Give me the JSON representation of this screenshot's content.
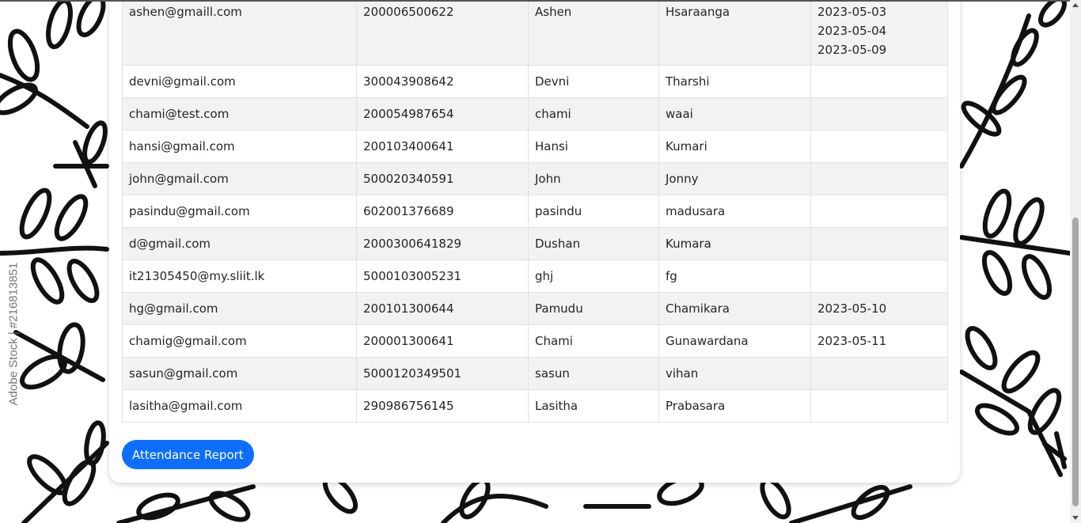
{
  "watermark": "Adobe Stock | #216813851",
  "table": {
    "rows": [
      {
        "email": "ashen@gmaill.com",
        "nic": "200006500622",
        "first": "Ashen",
        "last": "Hsaraanga",
        "dates": [
          "2023-05-03",
          "2023-05-04",
          "2023-05-09"
        ]
      },
      {
        "email": "devni@gmail.com",
        "nic": "300043908642",
        "first": "Devni",
        "last": "Tharshi",
        "dates": []
      },
      {
        "email": "chami@test.com",
        "nic": "200054987654",
        "first": "chami",
        "last": "waai",
        "dates": []
      },
      {
        "email": "hansi@gmail.com",
        "nic": "200103400641",
        "first": "Hansi",
        "last": "Kumari",
        "dates": []
      },
      {
        "email": "john@gmail.com",
        "nic": "500020340591",
        "first": "John",
        "last": "Jonny",
        "dates": []
      },
      {
        "email": "pasindu@gmail.com",
        "nic": "602001376689",
        "first": "pasindu",
        "last": "madusara",
        "dates": []
      },
      {
        "email": "d@gmail.com",
        "nic": "2000300641829",
        "first": "Dushan",
        "last": "Kumara",
        "dates": []
      },
      {
        "email": "it21305450@my.sliit.lk",
        "nic": "5000103005231",
        "first": "ghj",
        "last": "fg",
        "dates": []
      },
      {
        "email": "hg@gmail.com",
        "nic": "200101300644",
        "first": "Pamudu",
        "last": "Chamikara",
        "dates": [
          "2023-05-10"
        ]
      },
      {
        "email": "chamig@gmail.com",
        "nic": "200001300641",
        "first": "Chami",
        "last": "Gunawardana",
        "dates": [
          "2023-05-11"
        ]
      },
      {
        "email": "sasun@gmail.com",
        "nic": "5000120349501",
        "first": "sasun",
        "last": "vihan",
        "dates": []
      },
      {
        "email": "lasitha@gmail.com",
        "nic": "290986756145",
        "first": "Lasitha",
        "last": "Prabasara",
        "dates": []
      }
    ]
  },
  "button": {
    "report_label": "Attendance Report"
  },
  "colors": {
    "primary": "#0d6efd",
    "stripe": "#f2f2f2",
    "border": "#dee2e6"
  }
}
